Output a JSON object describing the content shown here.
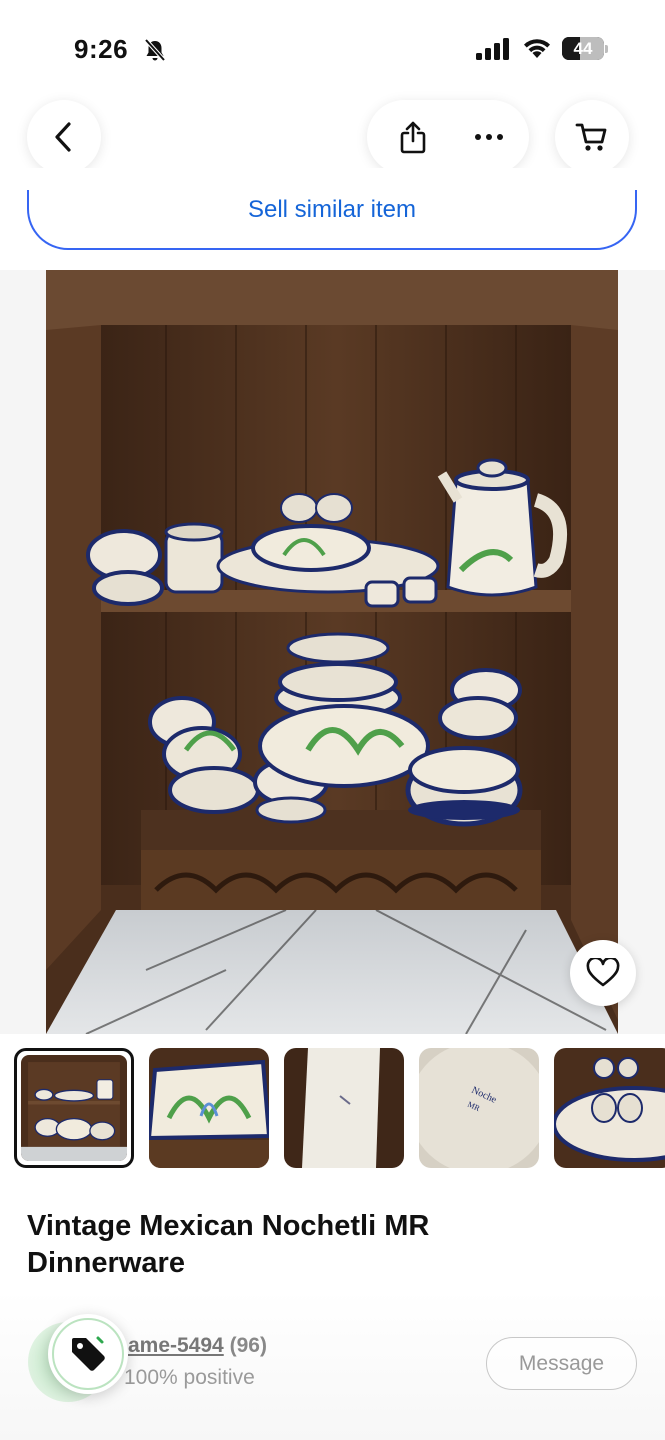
{
  "status_bar": {
    "time": "9:26",
    "battery_percent": "44",
    "battery_level": 0.44
  },
  "nav": {
    "back_icon": "chevron-left-icon",
    "share_icon": "share-icon",
    "more_icon": "more-horizontal-icon",
    "cart_icon": "cart-icon"
  },
  "sell_similar_label": "Sell similar item",
  "gallery": {
    "favorite_icon": "heart-outline-icon",
    "selected_index": 0,
    "thumbnail_count": 5
  },
  "listing": {
    "title": "Vintage Mexican Nochetli MR Dinnerware"
  },
  "seller": {
    "name": "ame-5494",
    "feedback_count": "(96)",
    "positive": "100% positive",
    "message_label": "Message"
  },
  "colors": {
    "accent_blue": "#3665f3",
    "link_blue": "#1565d8",
    "offer_green": "#7fd28c"
  }
}
